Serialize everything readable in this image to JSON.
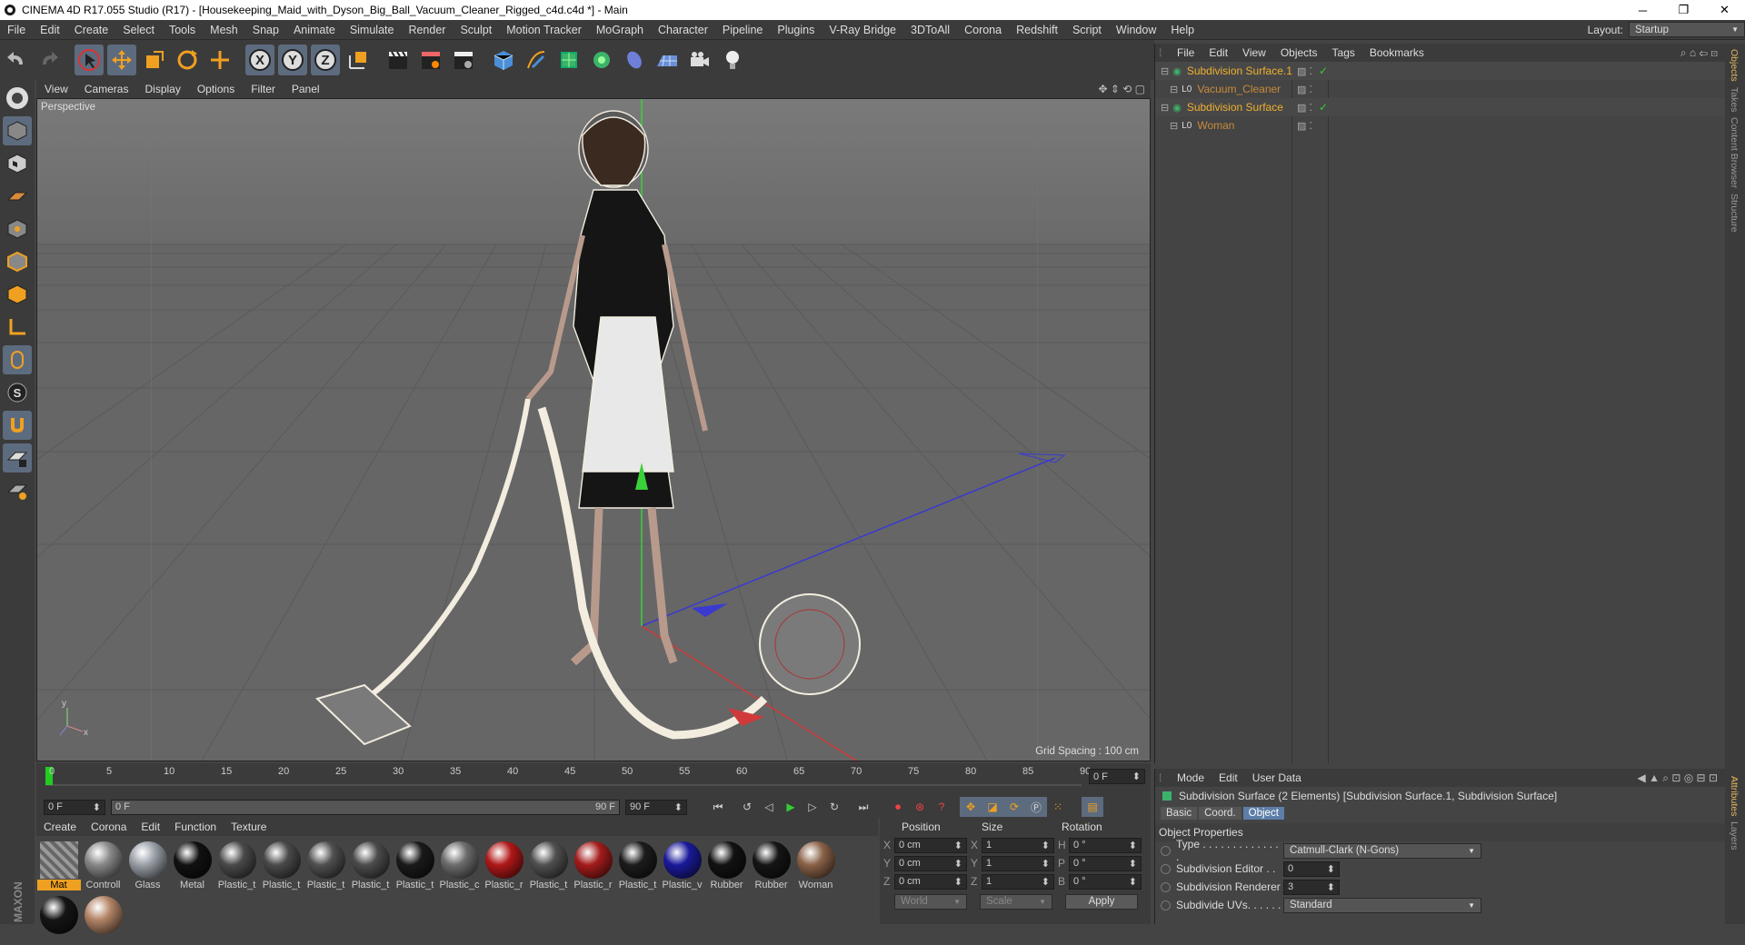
{
  "window": {
    "title": "CINEMA 4D R17.055 Studio (R17) - [Housekeeping_Maid_with_Dyson_Big_Ball_Vacuum_Cleaner_Rigged_c4d.c4d *] - Main",
    "minimize": "─",
    "maximize": "❐",
    "close": "✕"
  },
  "menubar": {
    "items": [
      "File",
      "Edit",
      "Create",
      "Select",
      "Tools",
      "Mesh",
      "Snap",
      "Animate",
      "Simulate",
      "Render",
      "Sculpt",
      "Motion Tracker",
      "MoGraph",
      "Character",
      "Pipeline",
      "Plugins",
      "V-Ray Bridge",
      "3DToAll",
      "Corona",
      "Redshift",
      "Script",
      "Window",
      "Help"
    ],
    "layout_label": "Layout:",
    "layout_value": "Startup"
  },
  "toolbar": {
    "axis_x": "X",
    "axis_y": "Y",
    "axis_z": "Z"
  },
  "viewport": {
    "menu": [
      "View",
      "Cameras",
      "Display",
      "Options",
      "Filter",
      "Panel"
    ],
    "label": "Perspective",
    "grid_spacing": "Grid Spacing : 100 cm",
    "axis_y": "y",
    "axis_x": "x"
  },
  "timeline": {
    "ticks": [
      "0",
      "5",
      "10",
      "15",
      "20",
      "25",
      "30",
      "35",
      "40",
      "45",
      "50",
      "55",
      "60",
      "65",
      "70",
      "75",
      "80",
      "85",
      "90"
    ],
    "current_frame": "0 F",
    "start_field": "0 F",
    "range_start": "0 F",
    "range_end": "90 F",
    "end_field": "90 F"
  },
  "material_manager": {
    "menu": [
      "Create",
      "Corona",
      "Edit",
      "Function",
      "Texture"
    ],
    "materials": [
      {
        "name": "Mat",
        "color": "#8a8a8a"
      },
      {
        "name": "Controll",
        "color": "#888888"
      },
      {
        "name": "Glass",
        "color": "#9aa0a8"
      },
      {
        "name": "Metal",
        "color": "#111111"
      },
      {
        "name": "Plastic_t",
        "color": "#4a4a4a"
      },
      {
        "name": "Plastic_t",
        "color": "#4a4a4a"
      },
      {
        "name": "Plastic_t",
        "color": "#505050"
      },
      {
        "name": "Plastic_t",
        "color": "#4c4c4c"
      },
      {
        "name": "Plastic_t",
        "color": "#1a1a1a"
      },
      {
        "name": "Plastic_c",
        "color": "#6c6c6c"
      },
      {
        "name": "Plastic_r",
        "color": "#b01818"
      },
      {
        "name": "Plastic_t",
        "color": "#505050"
      },
      {
        "name": "Plastic_r",
        "color": "#a41c1c"
      },
      {
        "name": "Plastic_t",
        "color": "#1c1c1c"
      },
      {
        "name": "Plastic_v",
        "color": "#1a1a9a"
      },
      {
        "name": "Rubber",
        "color": "#121212"
      },
      {
        "name": "Rubber",
        "color": "#151515"
      },
      {
        "name": "Woman",
        "color": "#8a6248"
      },
      {
        "name": "",
        "color": "#151515"
      },
      {
        "name": "",
        "color": "#b38466"
      }
    ]
  },
  "coordinates": {
    "headers": [
      "Position",
      "Size",
      "Rotation"
    ],
    "rows": [
      {
        "axis": "X",
        "pos": "0 cm",
        "size_axis": "X",
        "size": "1",
        "rot_axis": "H",
        "rot": "0 °"
      },
      {
        "axis": "Y",
        "pos": "0 cm",
        "size_axis": "Y",
        "size": "1",
        "rot_axis": "P",
        "rot": "0 °"
      },
      {
        "axis": "Z",
        "pos": "0 cm",
        "size_axis": "Z",
        "size": "1",
        "rot_axis": "B",
        "rot": "0 °"
      }
    ],
    "mode_world": "World",
    "mode_scale": "Scale",
    "apply": "Apply"
  },
  "object_manager": {
    "menu": [
      "File",
      "Edit",
      "View",
      "Objects",
      "Tags",
      "Bookmarks"
    ],
    "objects": [
      {
        "name": "Subdivision Surface.1",
        "color": "#f0b030",
        "level": 0,
        "check": "✓"
      },
      {
        "name": "Vacuum_Cleaner",
        "color": "#c88a3a",
        "level": 1,
        "check": ""
      },
      {
        "name": "Subdivision Surface",
        "color": "#f0b030",
        "level": 0,
        "check": "✓"
      },
      {
        "name": "Woman",
        "color": "#c88a3a",
        "level": 1,
        "check": ""
      }
    ]
  },
  "attribute_manager": {
    "menu": [
      "Mode",
      "Edit",
      "User Data"
    ],
    "title": "Subdivision Surface (2 Elements) [Subdivision Surface.1, Subdivision Surface]",
    "tabs": [
      "Basic",
      "Coord.",
      "Object"
    ],
    "section": "Object Properties",
    "props": [
      {
        "label": "Type . . . . . . . . . . . . . .",
        "value": "Catmull-Clark (N-Gons)",
        "kind": "dropdown"
      },
      {
        "label": "Subdivision Editor . .",
        "value": "0",
        "kind": "number"
      },
      {
        "label": "Subdivision Renderer",
        "value": "3",
        "kind": "number"
      },
      {
        "label": "Subdivide UVs. . . . . .",
        "value": "Standard",
        "kind": "dropdown"
      }
    ]
  },
  "right_tabs": [
    "Objects",
    "Takes",
    "Content Browser",
    "Structure"
  ],
  "right_tabs_bottom": [
    "Attributes",
    "Layers"
  ]
}
